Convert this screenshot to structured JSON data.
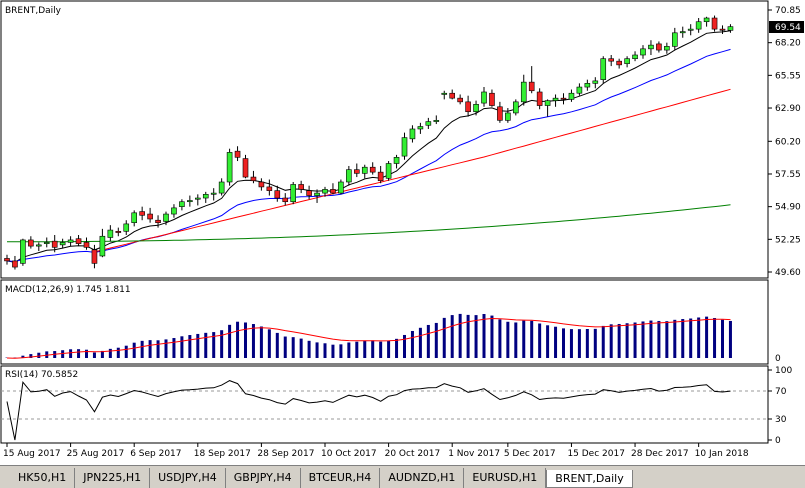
{
  "chart_data": {
    "type": "candlestick",
    "symbol_label": "BRENT,Daily",
    "price_axis": {
      "ticks": [
        "70.85",
        "68.20",
        "65.55",
        "62.90",
        "60.20",
        "57.55",
        "54.90",
        "52.25",
        "49.60"
      ],
      "current": "69.54"
    },
    "x_labels": [
      "15 Aug 2017",
      "25 Aug 2017",
      "6 Sep 2017",
      "18 Sep 2017",
      "28 Sep 2017",
      "10 Oct 2017",
      "20 Oct 2017",
      "1 Nov 2017",
      "5 Dec 2017",
      "15 Dec 2017",
      "28 Dec 2017",
      "10 Jan 2018"
    ],
    "ohlc": [
      [
        50.7,
        51.0,
        50.2,
        50.5
      ],
      [
        50.5,
        50.9,
        49.8,
        50.0
      ],
      [
        50.3,
        52.3,
        50.1,
        52.2
      ],
      [
        52.2,
        52.5,
        51.5,
        51.7
      ],
      [
        51.7,
        52.0,
        51.3,
        51.8
      ],
      [
        51.9,
        52.4,
        51.6,
        52.0
      ],
      [
        52.1,
        52.6,
        51.2,
        51.6
      ],
      [
        51.8,
        52.3,
        51.5,
        52.0
      ],
      [
        52.0,
        52.5,
        51.7,
        52.2
      ],
      [
        52.3,
        52.6,
        51.7,
        51.9
      ],
      [
        52.0,
        52.4,
        51.4,
        51.6
      ],
      [
        51.4,
        51.8,
        49.9,
        50.3
      ],
      [
        50.9,
        53.1,
        50.8,
        52.5
      ],
      [
        52.4,
        53.4,
        52.1,
        53.0
      ],
      [
        52.9,
        53.2,
        52.5,
        52.8
      ],
      [
        52.9,
        53.8,
        52.6,
        53.5
      ],
      [
        53.6,
        54.6,
        53.3,
        54.4
      ],
      [
        54.5,
        54.9,
        53.8,
        54.2
      ],
      [
        54.3,
        54.8,
        53.6,
        53.9
      ],
      [
        53.8,
        54.2,
        53.2,
        53.6
      ],
      [
        53.7,
        54.5,
        53.4,
        54.3
      ],
      [
        54.3,
        55.1,
        54.0,
        54.8
      ],
      [
        54.9,
        55.5,
        54.6,
        55.3
      ],
      [
        55.3,
        55.8,
        54.9,
        55.4
      ],
      [
        55.5,
        55.9,
        55.0,
        55.6
      ],
      [
        55.6,
        56.1,
        55.2,
        55.9
      ],
      [
        55.9,
        56.4,
        55.4,
        56.0
      ],
      [
        56.0,
        57.2,
        55.8,
        56.9
      ],
      [
        56.9,
        59.6,
        56.6,
        59.3
      ],
      [
        59.4,
        59.8,
        58.6,
        58.9
      ],
      [
        58.8,
        59.1,
        57.2,
        57.3
      ],
      [
        57.3,
        57.8,
        56.8,
        57.0
      ],
      [
        56.9,
        57.2,
        56.2,
        56.5
      ],
      [
        56.5,
        57.1,
        55.8,
        56.2
      ],
      [
        56.2,
        56.6,
        55.3,
        55.6
      ],
      [
        55.6,
        56.0,
        55.0,
        55.3
      ],
      [
        55.3,
        56.9,
        55.1,
        56.7
      ],
      [
        56.7,
        57.0,
        56.0,
        56.3
      ],
      [
        56.2,
        56.6,
        55.5,
        55.8
      ],
      [
        55.8,
        56.3,
        55.2,
        56.0
      ],
      [
        56.0,
        56.5,
        55.7,
        56.3
      ],
      [
        56.3,
        56.8,
        55.9,
        56.0
      ],
      [
        56.0,
        57.1,
        55.9,
        56.9
      ],
      [
        56.9,
        58.2,
        56.6,
        57.9
      ],
      [
        57.9,
        58.4,
        57.3,
        57.6
      ],
      [
        57.6,
        58.3,
        57.2,
        58.1
      ],
      [
        58.1,
        58.5,
        57.5,
        57.7
      ],
      [
        57.7,
        58.2,
        56.8,
        57.0
      ],
      [
        57.2,
        58.6,
        57.0,
        58.4
      ],
      [
        58.4,
        59.1,
        58.0,
        58.9
      ],
      [
        59.0,
        60.9,
        58.7,
        60.5
      ],
      [
        60.4,
        61.5,
        60.1,
        61.2
      ],
      [
        61.2,
        61.7,
        60.8,
        61.4
      ],
      [
        61.5,
        62.1,
        61.2,
        61.8
      ],
      [
        61.8,
        62.3,
        61.6,
        61.9
      ],
      [
        64.0,
        64.3,
        63.6,
        64.1
      ],
      [
        64.1,
        64.4,
        63.6,
        63.7
      ],
      [
        63.7,
        64.0,
        63.2,
        63.4
      ],
      [
        63.4,
        63.9,
        62.2,
        62.6
      ],
      [
        62.6,
        63.5,
        62.3,
        63.2
      ],
      [
        63.3,
        64.6,
        63.0,
        64.2
      ],
      [
        64.1,
        64.4,
        63.0,
        63.1
      ],
      [
        63.0,
        63.4,
        61.7,
        61.9
      ],
      [
        61.9,
        62.9,
        61.7,
        62.5
      ],
      [
        62.5,
        63.6,
        62.3,
        63.4
      ],
      [
        63.4,
        65.6,
        63.1,
        65.0
      ],
      [
        65.0,
        66.3,
        64.1,
        64.3
      ],
      [
        64.2,
        64.5,
        62.8,
        63.1
      ],
      [
        63.1,
        63.6,
        62.2,
        63.5
      ],
      [
        63.5,
        64.0,
        63.0,
        63.7
      ],
      [
        63.7,
        64.1,
        63.2,
        63.6
      ],
      [
        63.6,
        64.4,
        63.4,
        64.1
      ],
      [
        64.1,
        64.9,
        63.9,
        64.6
      ],
      [
        64.6,
        65.2,
        64.3,
        64.9
      ],
      [
        64.9,
        65.4,
        64.5,
        65.1
      ],
      [
        65.2,
        67.1,
        64.9,
        66.9
      ],
      [
        66.9,
        67.2,
        66.3,
        66.7
      ],
      [
        66.7,
        66.9,
        66.1,
        66.4
      ],
      [
        66.5,
        67.1,
        66.2,
        66.9
      ],
      [
        66.9,
        67.5,
        66.7,
        67.2
      ],
      [
        67.2,
        68.0,
        66.9,
        67.7
      ],
      [
        67.7,
        68.4,
        67.2,
        68.0
      ],
      [
        68.1,
        68.3,
        67.4,
        67.6
      ],
      [
        67.6,
        68.2,
        67.3,
        67.9
      ],
      [
        67.9,
        69.4,
        67.6,
        69.0
      ],
      [
        69.0,
        69.5,
        68.6,
        69.1
      ],
      [
        69.2,
        69.7,
        68.8,
        69.3
      ],
      [
        69.3,
        70.2,
        69.0,
        69.9
      ],
      [
        69.9,
        70.3,
        69.5,
        70.2
      ],
      [
        70.2,
        70.4,
        69.1,
        69.3
      ],
      [
        69.3,
        69.6,
        68.9,
        69.2
      ],
      [
        69.2,
        69.7,
        69.0,
        69.5
      ]
    ],
    "moving_averages": [
      "black",
      "blue",
      "red",
      "green"
    ],
    "macd": {
      "label": "MACD(12,26,9) 1.745 1.811",
      "ticks": [
        "0"
      ],
      "histogram_color": "#000080",
      "signal_color": "#ff0000"
    },
    "rsi": {
      "label": "RSI(14) 70.5852",
      "ticks": [
        "100",
        "70",
        "30",
        "0"
      ],
      "levels": [
        70,
        30
      ]
    },
    "colors": {
      "bull": "#33ee33",
      "bear": "#ee2222",
      "grid_line": "#000000"
    }
  },
  "tabs": [
    {
      "label": "HK50,H1"
    },
    {
      "label": "JPN225,H1"
    },
    {
      "label": "USDJPY,H4"
    },
    {
      "label": "GBPJPY,H4"
    },
    {
      "label": "BTCEUR,H4"
    },
    {
      "label": "AUDNZD,H1"
    },
    {
      "label": "EURUSD,H1"
    },
    {
      "label": "BRENT,Daily"
    }
  ],
  "active_tab": "BRENT,Daily"
}
